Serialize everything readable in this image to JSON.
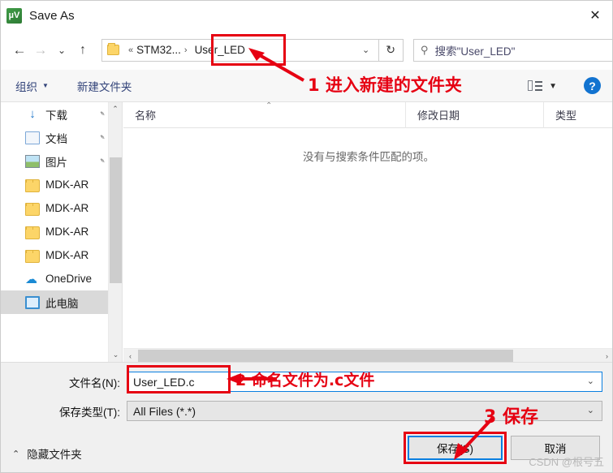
{
  "window": {
    "title": "Save As",
    "app_icon": "keil-uvision-icon",
    "close_label": "✕"
  },
  "nav": {
    "back": "←",
    "forward": "→",
    "recent": "⌄",
    "up": "↑",
    "refresh": "↻",
    "breadcrumb": {
      "overflow": "«",
      "parent": "STM32...",
      "separator": "›",
      "current": "User_LED",
      "dropdown": "⌄"
    }
  },
  "search": {
    "icon": "search-icon",
    "text": "搜索\"User_LED\""
  },
  "commandbar": {
    "organize": "组织",
    "organize_caret": "▼",
    "new_folder": "新建文件夹",
    "view_caret": "▼",
    "help": "?"
  },
  "sidebar": {
    "items": [
      {
        "label": "下载",
        "icon": "download-icon",
        "pinned": true,
        "selected": false
      },
      {
        "label": "文档",
        "icon": "document-icon",
        "pinned": true,
        "selected": false
      },
      {
        "label": "图片",
        "icon": "picture-icon",
        "pinned": true,
        "selected": false
      },
      {
        "label": "MDK-AR",
        "icon": "folder-icon",
        "pinned": false,
        "selected": false
      },
      {
        "label": "MDK-AR",
        "icon": "folder-icon",
        "pinned": false,
        "selected": false
      },
      {
        "label": "MDK-AR",
        "icon": "folder-icon",
        "pinned": false,
        "selected": false
      },
      {
        "label": "MDK-AR",
        "icon": "folder-icon",
        "pinned": false,
        "selected": false
      },
      {
        "label": "OneDrive",
        "icon": "onedrive-icon",
        "pinned": false,
        "selected": false
      },
      {
        "label": "此电脑",
        "icon": "this-pc-icon",
        "pinned": false,
        "selected": true
      }
    ],
    "scroll_up": "⌃",
    "scroll_down": "⌄"
  },
  "filelist": {
    "columns": [
      {
        "label": "名称"
      },
      {
        "label": "修改日期"
      },
      {
        "label": "类型"
      }
    ],
    "sort_indicator": "⌃",
    "empty_message": "没有与搜索条件匹配的项。",
    "rows": [],
    "hscroll_left": "‹",
    "hscroll_right": "›"
  },
  "bottom": {
    "filename_label": "文件名(N):",
    "filename_value": "User_LED.c",
    "filename_chevron": "⌄",
    "filetype_label": "保存类型(T):",
    "filetype_value": "All Files (*.*)",
    "filetype_chevron": "⌄",
    "hide_folders": "隐藏文件夹",
    "hide_folders_chevron": "⌃",
    "save_button": "保存(S)",
    "cancel_button": "取消"
  },
  "annotations": {
    "step1": "1 进入新建的文件夹",
    "step2": "2 命名文件为.c文件",
    "step3": "3 保存",
    "color": "#e60012"
  },
  "watermark": "CSDN @根号五"
}
